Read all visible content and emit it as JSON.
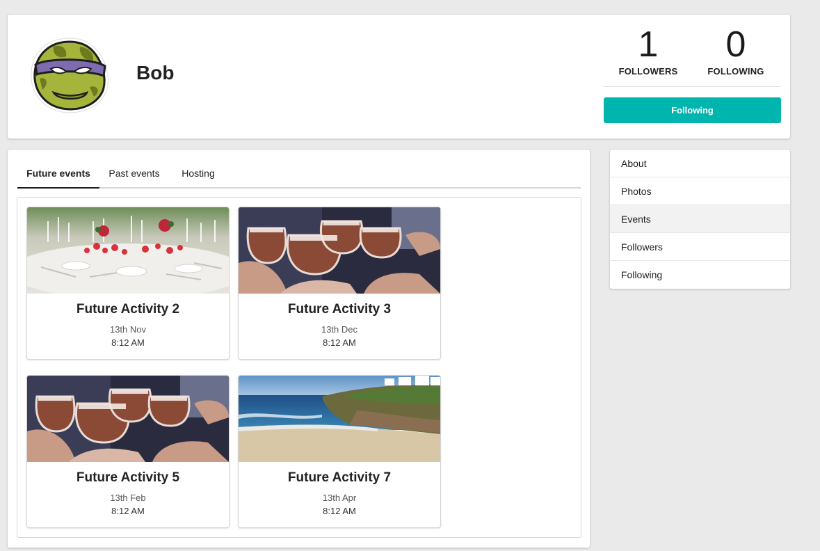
{
  "profile": {
    "name": "Bob",
    "followers_count": "1",
    "followers_label": "FOLLOWERS",
    "following_count": "0",
    "following_label": "FOLLOWING",
    "follow_button": "Following",
    "avatar_icon": "ninja-turtle-avatar"
  },
  "tabs": [
    {
      "label": "Future events",
      "active": true
    },
    {
      "label": "Past events",
      "active": false
    },
    {
      "label": "Hosting",
      "active": false
    }
  ],
  "events": [
    {
      "title": "Future Activity 2",
      "date": "13th Nov",
      "time": "8:12 AM",
      "image": "dinner-table"
    },
    {
      "title": "Future Activity 3",
      "date": "13th Dec",
      "time": "8:12 AM",
      "image": "drinks-toast"
    },
    {
      "title": "Future Activity 5",
      "date": "13th Feb",
      "time": "8:12 AM",
      "image": "drinks-toast"
    },
    {
      "title": "Future Activity 7",
      "date": "13th Apr",
      "time": "8:12 AM",
      "image": "beach-coast"
    }
  ],
  "side_menu": [
    {
      "label": "About",
      "active": false
    },
    {
      "label": "Photos",
      "active": false
    },
    {
      "label": "Events",
      "active": true
    },
    {
      "label": "Followers",
      "active": false
    },
    {
      "label": "Following",
      "active": false
    }
  ],
  "colors": {
    "accent": "#00b5ad",
    "background": "#eaeaea",
    "menu_active": "#f2f2f2"
  }
}
